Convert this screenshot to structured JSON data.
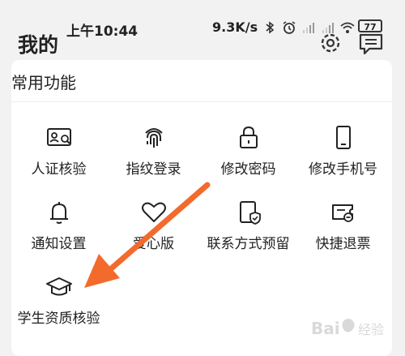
{
  "status_bar": {
    "time": "上午10:44",
    "net_speed": "9.3K/s",
    "battery": "77",
    "icons": [
      "bluetooth-icon",
      "alarm-icon",
      "signal-icon",
      "signal-icon",
      "wifi-icon",
      "battery-icon"
    ]
  },
  "header": {
    "title": "我的",
    "icons": [
      "settings-icon",
      "message-icon"
    ]
  },
  "section": {
    "title": "常用功能"
  },
  "tiles": [
    {
      "label": "人证核验",
      "icon": "id-card-verify-icon"
    },
    {
      "label": "指纹登录",
      "icon": "fingerprint-icon"
    },
    {
      "label": "修改密码",
      "icon": "lock-icon"
    },
    {
      "label": "修改手机号",
      "icon": "phone-icon"
    },
    {
      "label": "通知设置",
      "icon": "bell-icon"
    },
    {
      "label": "爱心版",
      "icon": "heart-icon"
    },
    {
      "label": "联系方式预留",
      "icon": "contact-shield-icon"
    },
    {
      "label": "快捷退票",
      "icon": "ticket-refund-icon"
    },
    {
      "label": "学生资质核验",
      "icon": "graduation-cap-icon"
    }
  ],
  "annotation": {
    "color": "#f26b2c"
  },
  "watermark": {
    "text": "Bai 经验"
  }
}
